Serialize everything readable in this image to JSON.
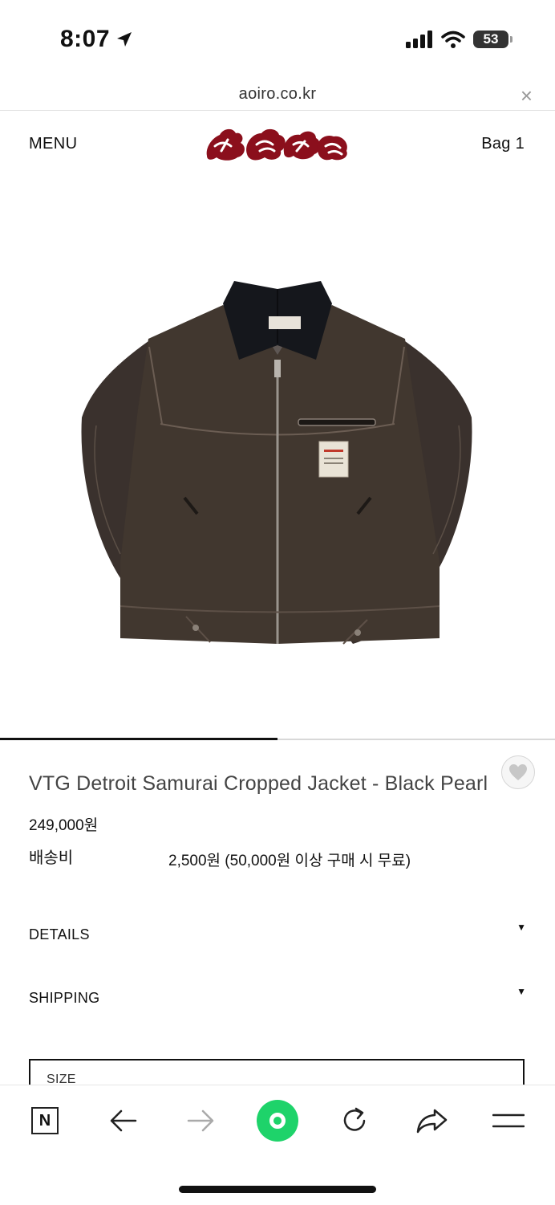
{
  "status_bar": {
    "time": "8:07",
    "battery": "53"
  },
  "browser": {
    "url": "aoiro.co.kr",
    "close": "×"
  },
  "header": {
    "menu": "MENU",
    "bag": "Bag 1"
  },
  "product": {
    "title": "VTG Detroit Samurai Cropped Jacket - Black Pearl",
    "price": "249,000원",
    "shipping_label": "배송비",
    "shipping_value": "2,500원 (50,000원 이상 구매 시 무료)",
    "image_slider_progress": 0.5
  },
  "accordion": [
    {
      "label": "DETAILS",
      "arrow": "▼"
    },
    {
      "label": "SHIPPING",
      "arrow": "▼"
    }
  ],
  "options": {
    "size_label": "SIZE"
  },
  "toolbar": {
    "naver": "N"
  },
  "colors": {
    "logo": "#8b0f1c",
    "toolbar_accent": "#1ed36a",
    "jacket": "#3a312d"
  }
}
